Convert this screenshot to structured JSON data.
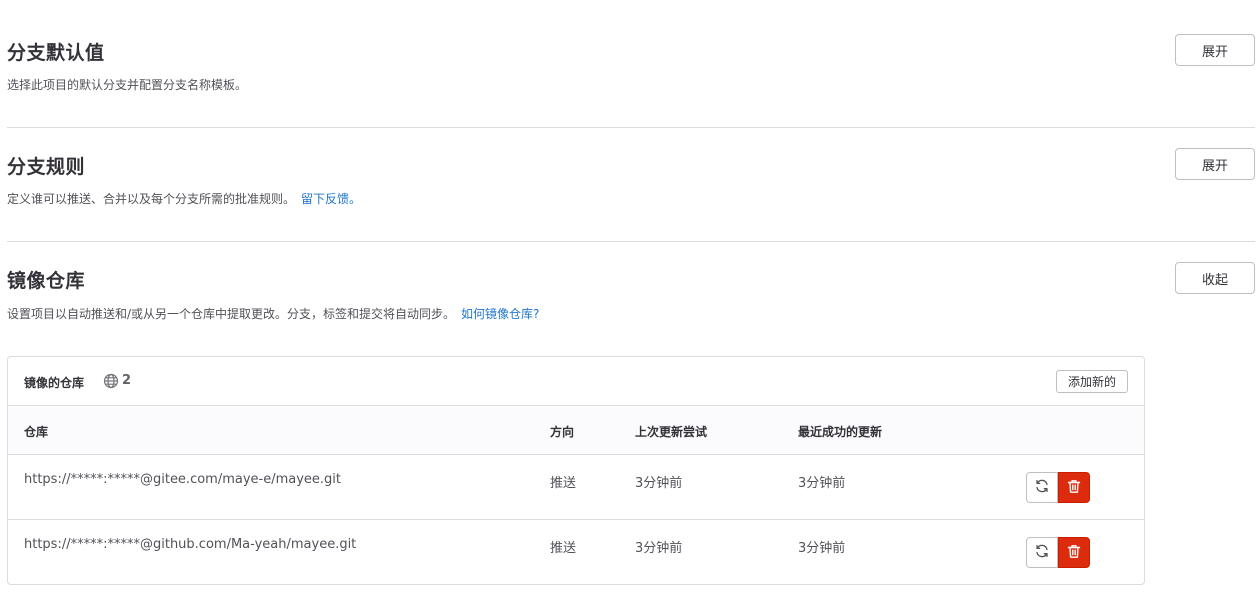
{
  "sections": [
    {
      "title": "分支默认值",
      "description": "选择此项目的默认分支并配置分支名称模板。",
      "link": "",
      "toggle_label": "展开"
    },
    {
      "title": "分支规则",
      "description": "定义谁可以推送、合并以及每个分支所需的批准规则。",
      "link": "留下反馈。",
      "toggle_label": "展开"
    },
    {
      "title": "镜像仓库",
      "description": "设置项目以自动推送和/或从另一个仓库中提取更改。分支，标签和提交将自动同步。",
      "link": "如何镜像仓库?",
      "toggle_label": "收起"
    }
  ],
  "mirrors": {
    "title": "镜像的仓库",
    "count_icon": "globe-icon",
    "count": "2",
    "add_label": "添加新的",
    "columns": [
      "仓库",
      "方向",
      "上次更新尝试",
      "最近成功的更新"
    ],
    "rows": [
      {
        "repo": "https://*****:*****@gitee.com/maye-e/mayee.git",
        "direction": "推送",
        "last_attempt": "3分钟前",
        "last_success": "3分钟前"
      },
      {
        "repo": "https://*****:*****@github.com/Ma-yeah/mayee.git",
        "direction": "推送",
        "last_attempt": "3分钟前",
        "last_success": "3分钟前"
      }
    ],
    "row_actions": {
      "sync_icon": "sync-icon",
      "delete_icon": "trash-icon"
    }
  },
  "colors": {
    "link": "#1f75cb",
    "danger": "#dd2b0e",
    "border": "#dcdcde",
    "text": "#333238"
  }
}
